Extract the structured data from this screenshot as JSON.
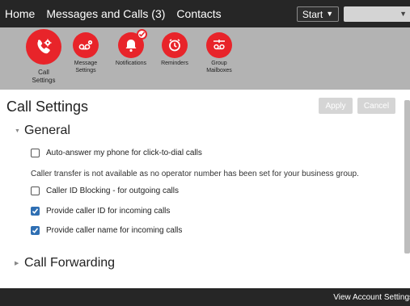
{
  "nav": {
    "home": "Home",
    "messages": "Messages and Calls (3)",
    "contacts": "Contacts",
    "start": "Start"
  },
  "toolbar": {
    "items": [
      {
        "label": "Call\nSettings",
        "icon": "phone-gear-icon",
        "active": true
      },
      {
        "label": "Message\nSettings",
        "icon": "voicemail-gear-icon"
      },
      {
        "label": "Notifications",
        "icon": "bell-check-icon"
      },
      {
        "label": "Reminders",
        "icon": "clock-icon"
      },
      {
        "label": "Group\nMailboxes",
        "icon": "group-mailbox-icon"
      }
    ]
  },
  "page": {
    "title": "Call Settings",
    "apply": "Apply",
    "cancel": "Cancel"
  },
  "general": {
    "heading": "General",
    "auto_answer": "Auto-answer my phone for click-to-dial calls",
    "transfer_note": "Caller transfer is not available as no operator number has been set for your business group.",
    "caller_id_blocking": "Caller ID Blocking - for outgoing calls",
    "provide_caller_id": "Provide caller ID for incoming calls",
    "provide_caller_name": "Provide caller name for incoming calls",
    "checked": {
      "auto_answer": false,
      "caller_id_blocking": false,
      "provide_caller_id": true,
      "provide_caller_name": true
    }
  },
  "call_forwarding": {
    "heading": "Call Forwarding"
  },
  "footer": {
    "view_account": "View Account Settings"
  },
  "colors": {
    "accent": "#e8242a",
    "topbar": "#262626",
    "iconbar": "#b3b3b3",
    "checkbox": "#2f6fb3"
  }
}
